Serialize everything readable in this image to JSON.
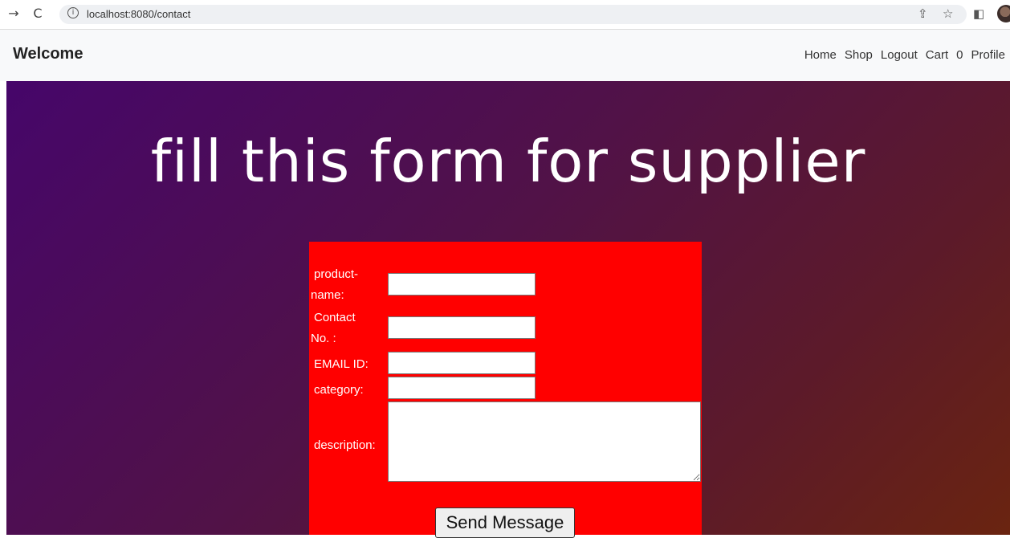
{
  "browser": {
    "url": "localhost:8080/contact"
  },
  "navbar": {
    "brand": "Welcome",
    "links": [
      {
        "label": "Home"
      },
      {
        "label": "Shop"
      },
      {
        "label": "Logout"
      },
      {
        "label": "Cart"
      },
      {
        "label": "0"
      },
      {
        "label": "Profile"
      }
    ]
  },
  "hero": {
    "title": "fill this form for supplier"
  },
  "form": {
    "product_name_label_1": "product-",
    "product_name_label_2": "name:",
    "contact_label_1": "Contact",
    "contact_label_2": "No. :",
    "email_label": "EMAIL ID:",
    "category_label": "category:",
    "description_label": "description:",
    "product_name_value": "",
    "contact_value": "",
    "email_value": "",
    "category_value": "",
    "description_value": "",
    "submit_label": "Send Message"
  },
  "colors": {
    "form_background": "#ff0000",
    "gradient_start": "#46066a",
    "gradient_end": "#6a2410"
  }
}
